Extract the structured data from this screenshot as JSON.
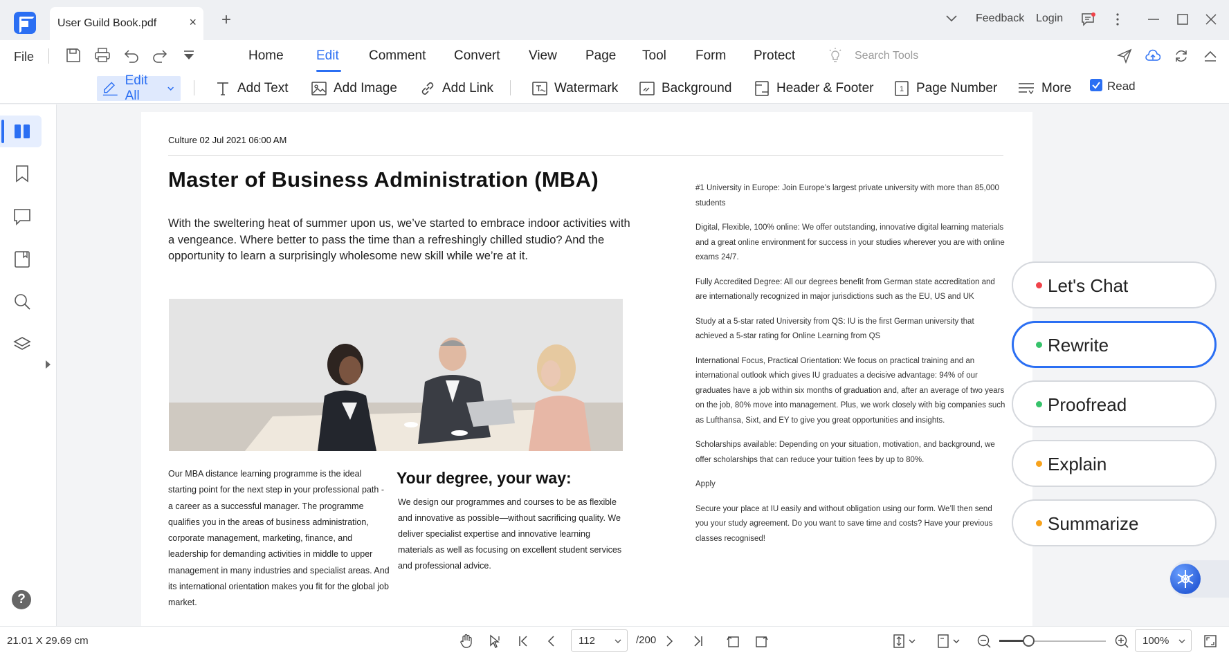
{
  "titlebar": {
    "tab_title": "User Guild Book.pdf",
    "close_glyph": "×",
    "new_tab_glyph": "+",
    "feedback": "Feedback",
    "login": "Login"
  },
  "menubar": {
    "file": "File",
    "items": [
      "Home",
      "Edit",
      "Comment",
      "Convert",
      "View",
      "Page",
      "Tool",
      "Form",
      "Protect"
    ],
    "active": "Edit",
    "search_placeholder": "Search Tools"
  },
  "toolbar": {
    "edit_all": "Edit All",
    "add_text": "Add Text",
    "add_image": "Add Image",
    "add_link": "Add Link",
    "watermark": "Watermark",
    "background": "Background",
    "header_footer": "Header & Footer",
    "page_number": "Page Number",
    "more": "More",
    "read": "Read",
    "read_checked": true
  },
  "sidebar": {
    "items": [
      "thumbnails-icon",
      "bookmark-icon",
      "comment-icon",
      "attachment-icon",
      "search-icon",
      "layers-icon"
    ],
    "help": "?"
  },
  "document": {
    "dateline": "Culture 02 Jul 2021 06:00 AM",
    "title": "Master of Business Administration (MBA)",
    "intro": "With the sweltering heat of summer upon us, we’ve started to embrace indoor activities with a vengeance. Where better to pass the time than a refreshingly chilled studio? And the opportunity to learn a surprisingly wholesome new skill while we’re at it.",
    "left_column": "Our MBA distance learning programme is the ideal starting point for the next step in your professional path - a career as a successful manager. The programme qualifies you in the areas of business administration, corporate management, marketing, finance, and leadership for demanding activities in middle to upper management in many industries and specialist areas. And its international orientation makes you fit for the global job market.",
    "subheading": "Your degree, your way:",
    "mid_column": "We design our programmes and courses to be as flexible and innovative as possible—without sacrificing quality. We deliver specialist expertise and innovative learning materials as well as focusing on excellent student services and professional advice.",
    "right_column": [
      "#1 University in Europe: Join Europe’s largest private university with more than 85,000 students",
      "Digital, Flexible, 100% online: We offer outstanding, innovative digital learning materials and a great online environment for success in your studies wherever you are with online exams 24/7.",
      "Fully Accredited Degree: All our degrees benefit from German state accreditation and are internationally recognized in major jurisdictions such as the EU, US and UK",
      "Study at a 5-star rated University from QS: IU is the first German university that achieved a 5-star rating for Online Learning from QS",
      "International Focus, Practical Orientation: We focus on practical training and an international outlook which gives IU graduates a decisive advantage: 94% of our graduates have a job within six months of graduation and, after an average of two years on the job, 80% move into management. Plus, we work closely with big companies such as Lufthansa, Sixt, and EY to give you great opportunities and insights.",
      "Scholarships available: Depending on your situation, motivation, and background, we offer scholarships that can reduce your tuition fees by up to 80%.",
      "Apply",
      "Secure your place at IU easily and without obligation using our form. We’ll then send you your study agreement. Do you want to save time and costs? Have your previous classes recognised!"
    ]
  },
  "ai_panel": {
    "buttons": [
      {
        "label": "Let's Chat",
        "dot": "#f0434a"
      },
      {
        "label": "Rewrite",
        "dot": "#36c26a"
      },
      {
        "label": "Proofread",
        "dot": "#36c26a"
      },
      {
        "label": "Explain",
        "dot": "#f7a21c"
      },
      {
        "label": "Summarize",
        "dot": "#f7a21c"
      }
    ],
    "active": "Rewrite"
  },
  "statusbar": {
    "page_size": "21.01 X 29.69 cm",
    "current_page": "112",
    "total_pages": "/200",
    "zoom": "100%",
    "zoom_level": 0.27
  },
  "colors": {
    "accent": "#2b6ff3",
    "red_dot": "#f0434a",
    "green_dot": "#36c26a",
    "orange_dot": "#f7a21c"
  }
}
